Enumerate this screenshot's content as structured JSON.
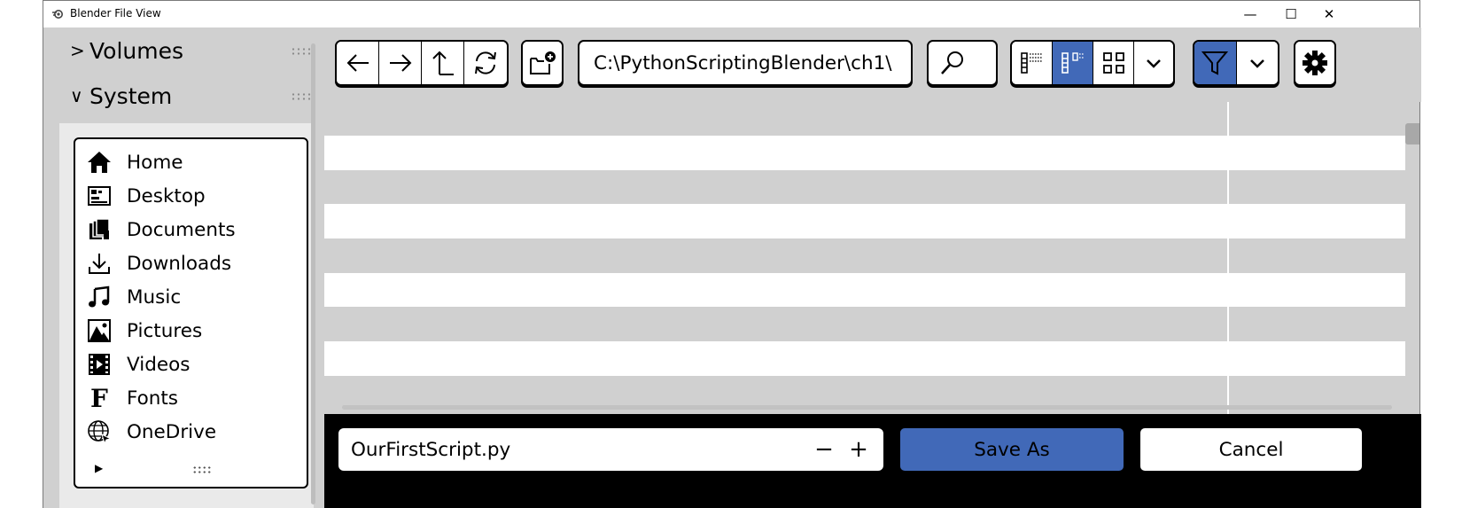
{
  "window": {
    "title": "Blender File View",
    "minimize_glyph": "—",
    "maximize_glyph": "☐",
    "close_glyph": "✕"
  },
  "sidebar": {
    "sections": [
      {
        "label": "Volumes",
        "expanded": false,
        "chevron": ">"
      },
      {
        "label": "System",
        "expanded": true,
        "chevron": "∨"
      }
    ],
    "bookmarks": [
      {
        "label": "Home",
        "icon": "home-icon"
      },
      {
        "label": "Desktop",
        "icon": "desktop-icon"
      },
      {
        "label": "Documents",
        "icon": "documents-icon"
      },
      {
        "label": "Downloads",
        "icon": "downloads-icon"
      },
      {
        "label": "Music",
        "icon": "music-icon"
      },
      {
        "label": "Pictures",
        "icon": "pictures-icon"
      },
      {
        "label": "Videos",
        "icon": "videos-icon"
      },
      {
        "label": "Fonts",
        "icon": "fonts-icon"
      },
      {
        "label": "OneDrive",
        "icon": "onedrive-icon"
      }
    ],
    "footer_arrow": "▶"
  },
  "toolbar": {
    "nav_buttons": [
      "back-arrow-icon",
      "forward-arrow-icon",
      "parent-dir-icon",
      "refresh-icon"
    ],
    "new_folder_icon": "new-folder-icon",
    "path": "C:\\PythonScriptingBlender\\ch1\\",
    "search_icon": "search-icon",
    "display_modes": [
      "vertical-list-icon",
      "horizontal-list-icon",
      "thumbnails-icon"
    ],
    "active_display_mode": "horizontal-list-icon",
    "filter_active": true,
    "accent_color": "#4169b8"
  },
  "filelist": {
    "row_count": 9,
    "row_colors": [
      "#d0d0d0",
      "#ffffff"
    ]
  },
  "bottom": {
    "filename": "OurFirstScript.py",
    "minus": "−",
    "plus": "+",
    "save_label": "Save As",
    "cancel_label": "Cancel"
  }
}
